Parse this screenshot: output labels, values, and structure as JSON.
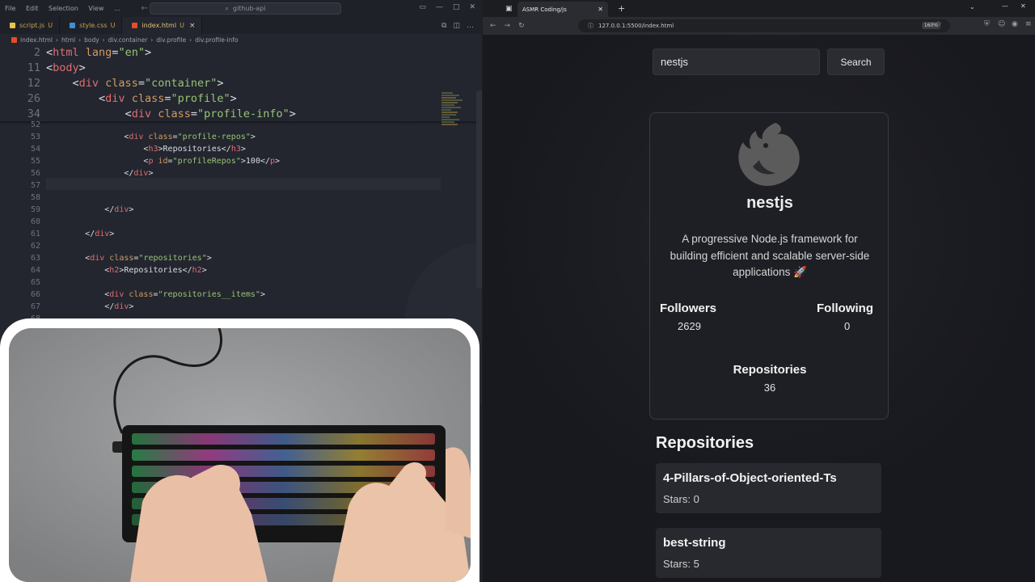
{
  "vscode": {
    "menu": [
      "File",
      "Edit",
      "Selection",
      "View",
      "..."
    ],
    "search_placeholder": "github-api",
    "tabs": [
      {
        "label": "script.js",
        "status": "U",
        "icon_color": "#e8c547"
      },
      {
        "label": "style.css",
        "status": "U",
        "icon_color": "#3d8fd6"
      },
      {
        "label": "index.html",
        "status": "U",
        "icon_color": "#e44d26",
        "active": true
      }
    ],
    "breadcrumbs": [
      "index.html",
      "html",
      "body",
      "div.container",
      "div.profile",
      "div.profile-info"
    ],
    "sticky_lines": [
      {
        "num": "2",
        "indent": "",
        "parts": [
          [
            "punc",
            "<"
          ],
          [
            "tag",
            "html"
          ],
          [
            "attr",
            " lang"
          ],
          [
            "punc",
            "="
          ],
          [
            "str",
            "\"en\""
          ],
          [
            "punc",
            ">"
          ]
        ]
      },
      {
        "num": "11",
        "indent": "",
        "parts": [
          [
            "punc",
            "<"
          ],
          [
            "tag",
            "body"
          ],
          [
            "punc",
            ">"
          ]
        ]
      },
      {
        "num": "12",
        "indent": "    ",
        "parts": [
          [
            "punc",
            "<"
          ],
          [
            "tag",
            "div"
          ],
          [
            "attr",
            " class"
          ],
          [
            "punc",
            "="
          ],
          [
            "str",
            "\"container\""
          ],
          [
            "punc",
            ">"
          ]
        ]
      },
      {
        "num": "26",
        "indent": "        ",
        "parts": [
          [
            "punc",
            "<"
          ],
          [
            "tag",
            "div"
          ],
          [
            "attr",
            " class"
          ],
          [
            "punc",
            "="
          ],
          [
            "str",
            "\"profile\""
          ],
          [
            "punc",
            ">"
          ]
        ]
      },
      {
        "num": "34",
        "indent": "            ",
        "parts": [
          [
            "punc",
            "<"
          ],
          [
            "tag",
            "div"
          ],
          [
            "attr",
            " class"
          ],
          [
            "punc",
            "="
          ],
          [
            "str",
            "\"profile-info\""
          ],
          [
            "punc",
            ">"
          ]
        ]
      }
    ],
    "code_lines": [
      {
        "num": "52",
        "indent": "",
        "parts": []
      },
      {
        "num": "53",
        "indent": "                ",
        "parts": [
          [
            "punc",
            "<"
          ],
          [
            "tag",
            "div"
          ],
          [
            "attr",
            " class"
          ],
          [
            "punc",
            "="
          ],
          [
            "str",
            "\"profile-repos\""
          ],
          [
            "punc",
            ">"
          ]
        ]
      },
      {
        "num": "54",
        "indent": "                    ",
        "parts": [
          [
            "punc",
            "<"
          ],
          [
            "tag",
            "h3"
          ],
          [
            "punc",
            ">"
          ],
          [
            "text",
            "Repositories"
          ],
          [
            "punc",
            "</"
          ],
          [
            "tag",
            "h3"
          ],
          [
            "punc",
            ">"
          ]
        ]
      },
      {
        "num": "55",
        "indent": "                    ",
        "parts": [
          [
            "punc",
            "<"
          ],
          [
            "tag",
            "p"
          ],
          [
            "attr",
            " id"
          ],
          [
            "punc",
            "="
          ],
          [
            "str",
            "\"profileRepos\""
          ],
          [
            "punc",
            ">"
          ],
          [
            "text",
            "100"
          ],
          [
            "punc",
            "</"
          ],
          [
            "tag",
            "p"
          ],
          [
            "punc",
            ">"
          ]
        ]
      },
      {
        "num": "56",
        "indent": "                ",
        "parts": [
          [
            "punc",
            "</"
          ],
          [
            "tag",
            "div"
          ],
          [
            "punc",
            ">"
          ]
        ]
      },
      {
        "num": "57",
        "indent": "",
        "parts": []
      },
      {
        "num": "58",
        "indent": "",
        "parts": []
      },
      {
        "num": "59",
        "indent": "            ",
        "parts": [
          [
            "punc",
            "</"
          ],
          [
            "tag",
            "div"
          ],
          [
            "punc",
            ">"
          ]
        ]
      },
      {
        "num": "60",
        "indent": "",
        "parts": []
      },
      {
        "num": "61",
        "indent": "        ",
        "parts": [
          [
            "punc",
            "</"
          ],
          [
            "tag",
            "div"
          ],
          [
            "punc",
            ">"
          ]
        ]
      },
      {
        "num": "62",
        "indent": "",
        "parts": []
      },
      {
        "num": "63",
        "indent": "        ",
        "parts": [
          [
            "punc",
            "<"
          ],
          [
            "tag",
            "div"
          ],
          [
            "attr",
            " class"
          ],
          [
            "punc",
            "="
          ],
          [
            "str",
            "\"repositories\""
          ],
          [
            "punc",
            ">"
          ]
        ]
      },
      {
        "num": "64",
        "indent": "            ",
        "parts": [
          [
            "punc",
            "<"
          ],
          [
            "tag",
            "h2"
          ],
          [
            "punc",
            ">"
          ],
          [
            "text",
            "Repositories"
          ],
          [
            "punc",
            "</"
          ],
          [
            "tag",
            "h2"
          ],
          [
            "punc",
            ">"
          ]
        ]
      },
      {
        "num": "65",
        "indent": "",
        "parts": []
      },
      {
        "num": "66",
        "indent": "            ",
        "parts": [
          [
            "punc",
            "<"
          ],
          [
            "tag",
            "div"
          ],
          [
            "attr",
            " class"
          ],
          [
            "punc",
            "="
          ],
          [
            "str",
            "\"repositories__items\""
          ],
          [
            "punc",
            ">"
          ]
        ]
      },
      {
        "num": "67",
        "indent": "            ",
        "parts": [
          [
            "punc",
            "</"
          ],
          [
            "tag",
            "div"
          ],
          [
            "punc",
            ">"
          ]
        ]
      },
      {
        "num": "68",
        "indent": "",
        "parts": []
      }
    ]
  },
  "browser": {
    "tab_title": "ASMR Coding/js",
    "url": "127.0.0.1:5500/index.html",
    "zoom": "160%",
    "search": {
      "value": "nestjs",
      "button": "Search"
    },
    "profile": {
      "name": "nestjs",
      "bio": "A progressive Node.js framework for building efficient and scalable server-side applications 🚀",
      "followers_label": "Followers",
      "followers": "2629",
      "following_label": "Following",
      "following": "0",
      "repos_label": "Repositories",
      "repos": "36"
    },
    "repositories_heading": "Repositories",
    "repositories": [
      {
        "name": "4-Pillars-of-Object-oriented-Ts",
        "stars": "Stars: 0"
      },
      {
        "name": "best-string",
        "stars": "Stars: 5"
      }
    ]
  }
}
